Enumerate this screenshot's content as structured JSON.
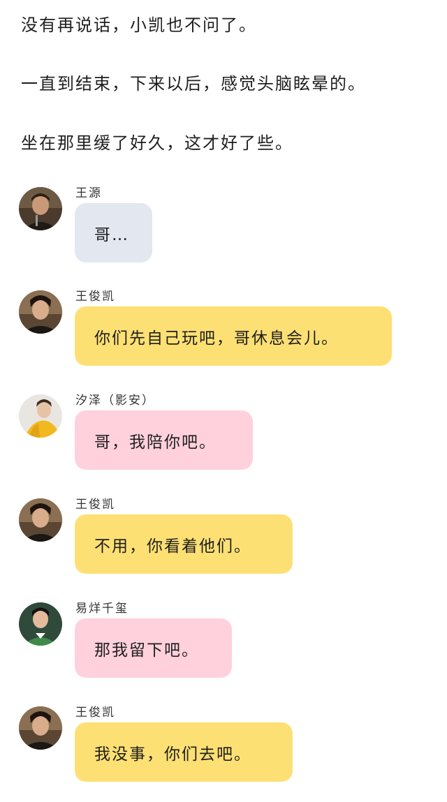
{
  "narration": [
    "没有再说话，小凯也不问了。",
    "一直到结束，下来以后，感觉头脑眩晕的。",
    "坐在那里缓了好久，这才好了些。"
  ],
  "messages": [
    {
      "sender": "王源",
      "text": "哥…",
      "bubble_color": "#e3e8f0",
      "avatar_icon": "avatar-wangyuan-icon"
    },
    {
      "sender": "王俊凯",
      "text": "你们先自己玩吧，哥休息会儿。",
      "bubble_color": "#fde074",
      "avatar_icon": "avatar-wangjunkai-icon"
    },
    {
      "sender": "汐泽（影安）",
      "text": "哥，我陪你吧。",
      "bubble_color": "#ffd1dc",
      "avatar_icon": "avatar-xize-icon"
    },
    {
      "sender": "王俊凯",
      "text": "不用，你看着他们。",
      "bubble_color": "#fde074",
      "avatar_icon": "avatar-wangjunkai-icon"
    },
    {
      "sender": "易烊千玺",
      "text": "那我留下吧。",
      "bubble_color": "#ffd1dc",
      "avatar_icon": "avatar-yiyangqianxi-icon"
    },
    {
      "sender": "王俊凯",
      "text": "我没事，你们去吧。",
      "bubble_color": "#fde074",
      "avatar_icon": "avatar-wangjunkai-icon"
    }
  ]
}
